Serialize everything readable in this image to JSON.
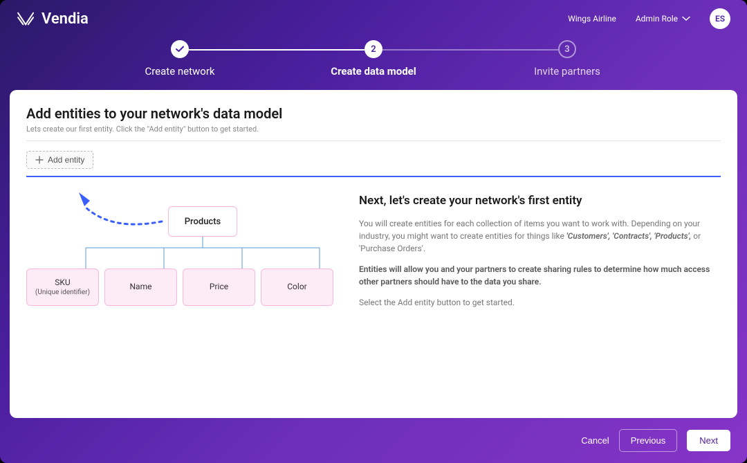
{
  "header": {
    "brand": "Vendia",
    "org": "Wings Airline",
    "role": "Admin Role",
    "avatar": "ES"
  },
  "stepper": {
    "step1": {
      "label": "Create network"
    },
    "step2": {
      "num": "2",
      "label": "Create data model"
    },
    "step3": {
      "num": "3",
      "label": "Invite partners"
    }
  },
  "page": {
    "title": "Add entities to your network's data model",
    "subtitle": "Lets create our first entity. Click the \"Add entity\" button to get started.",
    "add_entity_label": "Add entity"
  },
  "diagram": {
    "root": "Products",
    "attrs": {
      "a1": {
        "name": "SKU",
        "sub": "(Unique identifier)"
      },
      "a2": {
        "name": "Name"
      },
      "a3": {
        "name": "Price"
      },
      "a4": {
        "name": "Color"
      }
    }
  },
  "info": {
    "title": "Next, let's create your network's first entity",
    "p1a": "You will create entities for each collection of items you want to work with. Depending on your industry, you might want to create entities for things like ",
    "p1_eg": "'Customers', 'Contracts', 'Products',",
    "p1b": " or 'Purchase Orders'.",
    "p2": "Entities will allow you and your partners to create sharing rules to determine how much access other partners should have to the data you share.",
    "p3": "Select the Add entity button to get started."
  },
  "footer": {
    "cancel": "Cancel",
    "previous": "Previous",
    "next": "Next"
  }
}
